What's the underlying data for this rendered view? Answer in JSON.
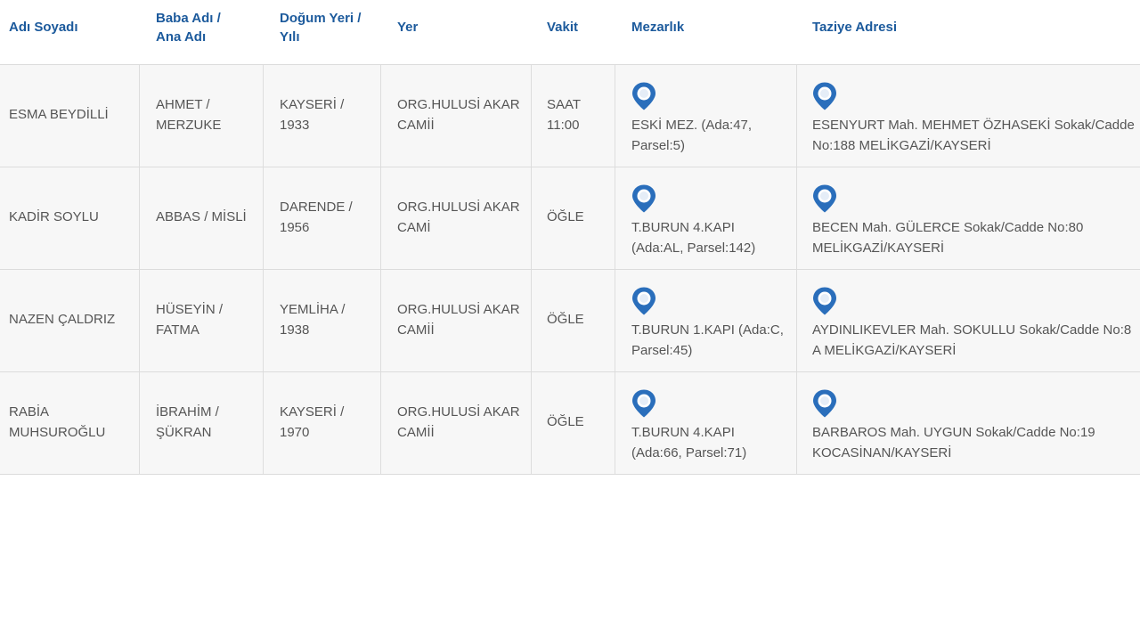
{
  "colors": {
    "header_text": "#1c5a9c",
    "cell_text": "#555555",
    "row_bg": "#f7f7f7",
    "pin": "#2a6ebb"
  },
  "headers": {
    "name": "Adı Soyadı",
    "parents_line1": "Baba Adı /",
    "parents_line2": "Ana Adı",
    "birth_line1": "Doğum Yeri /",
    "birth_line2": "Yılı",
    "place": "Yer",
    "time": "Vakit",
    "cemetery": "Mezarlık",
    "address": "Taziye Adresi"
  },
  "rows": [
    {
      "name": [
        "ESMA BEYDİLLİ"
      ],
      "parents": [
        "AHMET /",
        "MERZUKE"
      ],
      "birth": [
        "KAYSERİ /",
        "1933"
      ],
      "place": [
        "ORG.HULUSİ AKAR",
        "CAMİİ"
      ],
      "time": [
        "SAAT",
        "11:00"
      ],
      "cemetery": [
        "ESKİ MEZ. (Ada:47,",
        "Parsel:5)"
      ],
      "cemetery_icon": "map-pin-icon",
      "address": [
        "ESENYURT Mah. MEHMET ÖZHASEKİ Sokak/Cadde",
        "No:188 MELİKGAZİ/KAYSERİ"
      ],
      "address_icon": "map-pin-icon"
    },
    {
      "name": [
        "KADİR SOYLU"
      ],
      "parents": [
        "ABBAS / MİSLİ"
      ],
      "birth": [
        "DARENDE /",
        "1956"
      ],
      "place": [
        "ORG.HULUSİ AKAR",
        "CAMİ"
      ],
      "time": [
        "ÖĞLE"
      ],
      "cemetery": [
        "T.BURUN 4.KAPI",
        "(Ada:AL, Parsel:142)"
      ],
      "cemetery_icon": "map-pin-icon",
      "address": [
        "BECEN Mah. GÜLERCE Sokak/Cadde No:80",
        "MELİKGAZİ/KAYSERİ"
      ],
      "address_icon": "map-pin-icon"
    },
    {
      "name": [
        "NAZEN ÇALDRIZ"
      ],
      "parents": [
        "HÜSEYİN /",
        "FATMA"
      ],
      "birth": [
        "YEMLİHA /",
        "1938"
      ],
      "place": [
        "ORG.HULUSİ AKAR",
        "CAMİİ"
      ],
      "time": [
        "ÖĞLE"
      ],
      "cemetery": [
        "T.BURUN 1.KAPI (Ada:C,",
        "Parsel:45)"
      ],
      "cemetery_icon": "map-pin-icon",
      "address": [
        "AYDINLIKEVLER Mah. SOKULLU Sokak/Cadde No:8",
        "A MELİKGAZİ/KAYSERİ"
      ],
      "address_icon": "map-pin-icon"
    },
    {
      "name": [
        "RABİA",
        "MUHSUROĞLU"
      ],
      "parents": [
        "İBRAHİM /",
        "ŞÜKRAN"
      ],
      "birth": [
        "KAYSERİ /",
        "1970"
      ],
      "place": [
        "ORG.HULUSİ AKAR",
        "CAMİİ"
      ],
      "time": [
        "ÖĞLE"
      ],
      "cemetery": [
        "T.BURUN 4.KAPI",
        "(Ada:66, Parsel:71)"
      ],
      "cemetery_icon": "map-pin-icon",
      "address": [
        "BARBAROS Mah. UYGUN Sokak/Cadde No:19",
        "KOCASİNAN/KAYSERİ"
      ],
      "address_icon": "map-pin-icon"
    }
  ]
}
